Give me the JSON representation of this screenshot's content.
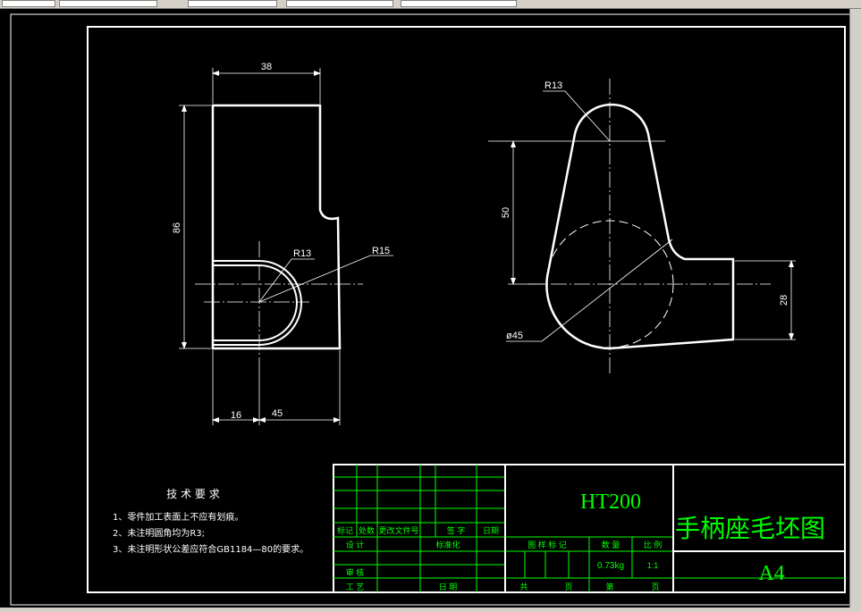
{
  "colors": {
    "background": "#000000",
    "line": "#ffffff",
    "annotation": "#00ff00"
  },
  "drawing": {
    "dims": {
      "width_top": "38",
      "height_left": "86",
      "radius_inner": "R13",
      "radius_outer": "R15",
      "base_left": "16",
      "base_right": "45",
      "radius_top": "R13",
      "center_distance": "50",
      "diameter": "ø45",
      "boss_height": "28"
    }
  },
  "tech_requirements": {
    "title": "技 术 要 求",
    "items": [
      "1、零件加工表面上不应有划痕。",
      "2、未注明圆角均为R3;",
      "3、未注明形状公差应符合GB1184—80的要求。"
    ]
  },
  "title_block": {
    "material": "HT200",
    "part_name": "手柄座毛坯图",
    "sheet_size": "A4",
    "row_labels": [
      "标记",
      "处数",
      "更改文件号",
      "签 字",
      "日期"
    ],
    "design": "设 计",
    "standardize": "标准化",
    "review": "审 核",
    "process": "工 艺",
    "date": "日 期",
    "stage_mark": "图 样 标 记",
    "quantity_label": "数 量",
    "scale_label": "比 例",
    "weight": "0.73kg",
    "scale": "1:1",
    "total_label": "共",
    "page_label": "页",
    "sheet_label": "第",
    "sheet_page_label": "页"
  }
}
